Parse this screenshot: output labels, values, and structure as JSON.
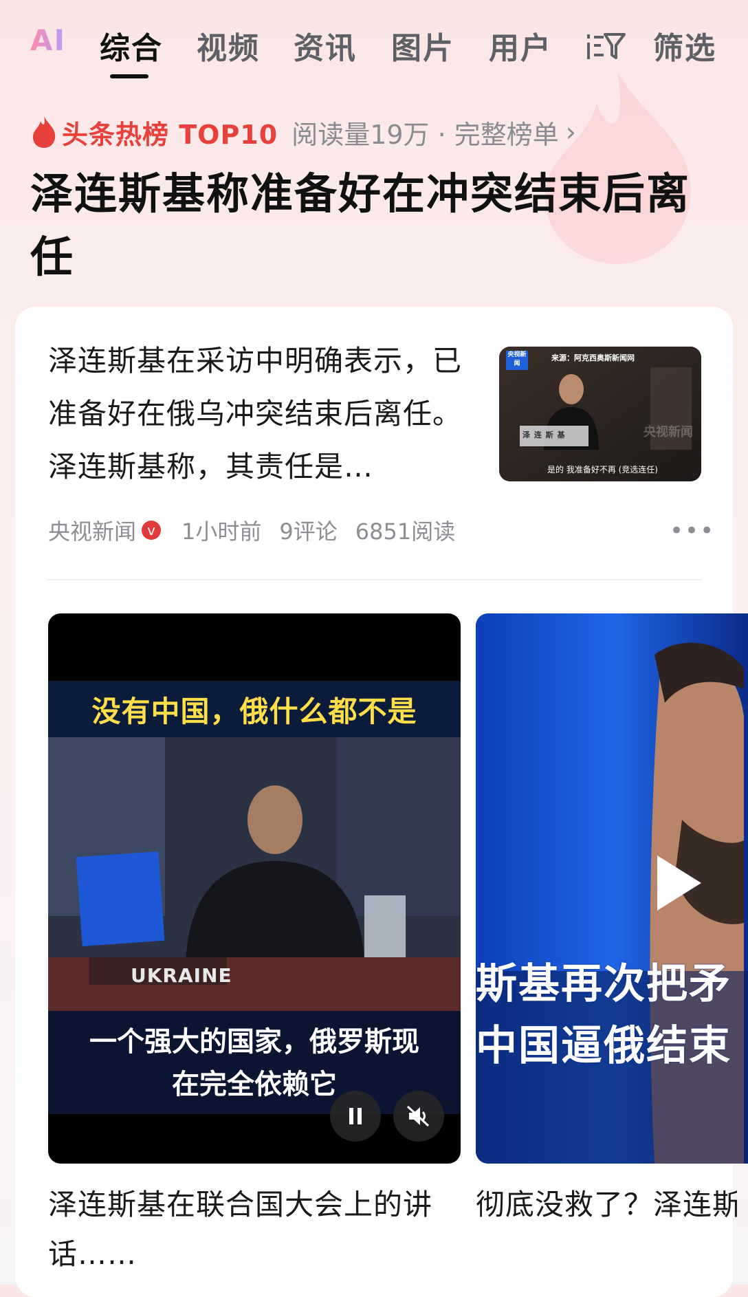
{
  "tabs": [
    {
      "label": "AI"
    },
    {
      "label": "综合"
    },
    {
      "label": "视频"
    },
    {
      "label": "资讯"
    },
    {
      "label": "图片"
    },
    {
      "label": "用户"
    },
    {
      "label": "筛选"
    }
  ],
  "active_tab": "综合",
  "hot_list": {
    "title": "头条热榜 TOP10",
    "meta": "阅读量19万 · 完整榜单",
    "chevron": "›"
  },
  "headline": "泽连斯基称准备好在冲突结束后离任",
  "article": {
    "snippet": "泽连斯基在采访中明确表示，已准备好在俄乌冲突结束后离任。泽连斯基称，其责任是…",
    "source": "央视新闻",
    "verified_badge": "v",
    "time": "1小时前",
    "comments": "9评论",
    "reads": "6851阅读",
    "more": "•••",
    "thumbnail": {
      "logo": "央视新闻",
      "source_caption": "来源：阿克西奥斯新闻网",
      "name_caption": "泽 连 斯 基",
      "subtitle": "是的 我准备好不再 (竞选连任)",
      "watermark": "央视新闻"
    }
  },
  "videos": [
    {
      "caption_top": "没有中国，俄什么都不是",
      "nameplate": "UKRAINE",
      "caption_bottom_1": "一个强大的国家，俄罗斯现",
      "caption_bottom_2": "在完全依赖它",
      "title": "泽连斯基在联合国大会上的讲话……",
      "pause_icon": "pause-icon",
      "mute_icon": "mute-icon"
    },
    {
      "overlay_1": "斯基再次把矛",
      "overlay_2": "中国逼俄结束",
      "title": "彻底没救了？泽连斯基把矛头指向中国"
    }
  ],
  "colors": {
    "accent_red": "#e8413b",
    "text_gray": "#8d8d93",
    "caption_yellow": "#ffde4a"
  }
}
